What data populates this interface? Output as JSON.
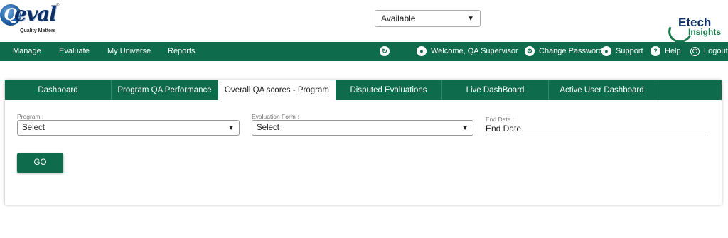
{
  "header": {
    "logo_main": "Q-Eval",
    "logo_tagline": "Quality Matters",
    "logo_reg": "®",
    "status_select": {
      "value": "Available"
    },
    "logo_right_line1": "Etech",
    "logo_right_line2": "Insights"
  },
  "nav": {
    "left_items": [
      "Manage",
      "Evaluate",
      "My Universe",
      "Reports"
    ],
    "welcome": "Welcome, QA Supervisor",
    "change_password": "Change Password",
    "support": "Support",
    "help": "Help",
    "logout": "Logout",
    "icons": [
      "refresh-icon",
      "user-icon",
      "gear-icon",
      "support-icon",
      "help-icon",
      "power-icon"
    ]
  },
  "tabs": [
    "Dashboard",
    "Program QA Performance",
    "Overall QA scores - Program",
    "Disputed Evaluations",
    "Live DashBoard",
    "Active User Dashboard"
  ],
  "active_tab_index": 2,
  "form": {
    "program_label": "Program :",
    "program_value": "Select",
    "evaluation_form_label": "Evaluation Form :",
    "evaluation_form_value": "Select",
    "end_date_label": "End Date :",
    "end_date_value": "End Date",
    "go_label": "GO"
  },
  "colors": {
    "brand_green": "#0e6b4b",
    "logo_blue": "#0b2f66"
  }
}
